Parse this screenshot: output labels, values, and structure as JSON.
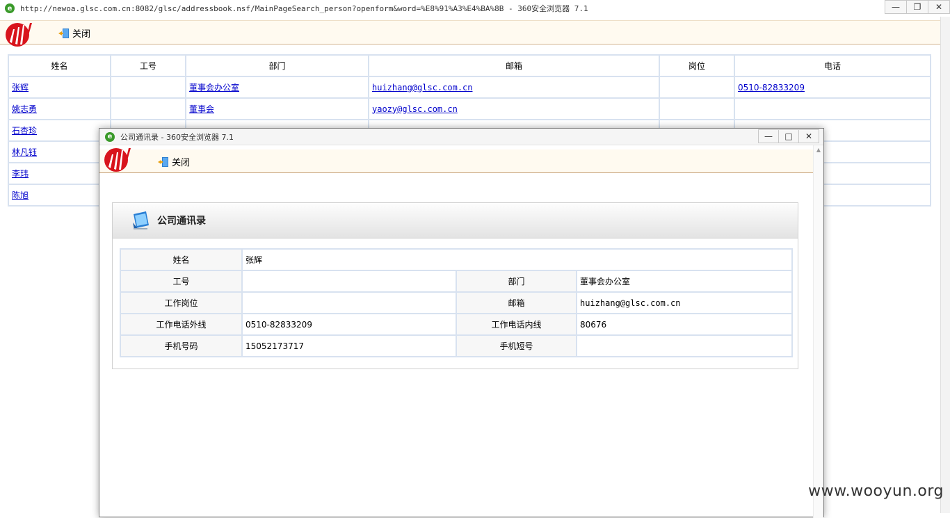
{
  "outer_window": {
    "title": "http://newoa.glsc.com.cn:8082/glsc/addressbook.nsf/MainPageSearch_person?openform&word=%E8%91%A3%E4%BA%8B - 360安全浏览器 7.1",
    "close_label": "关闭"
  },
  "results_table": {
    "headers": [
      "姓名",
      "工号",
      "部门",
      "邮箱",
      "岗位",
      "电话"
    ],
    "rows": [
      {
        "name": "张辉",
        "id": "",
        "dept": "董事会办公室",
        "email": "huizhang@glsc.com.cn",
        "post": "",
        "phone": "0510-82833209"
      },
      {
        "name": "姚志勇",
        "id": "",
        "dept": "董事会",
        "email": "yaozy@glsc.com.cn",
        "post": "",
        "phone": ""
      },
      {
        "name": "石杏珍",
        "id": "",
        "dept": "",
        "email": "",
        "post": "",
        "phone": ""
      },
      {
        "name": "林凡钰",
        "id": "",
        "dept": "",
        "email": "",
        "post": "",
        "phone": ""
      },
      {
        "name": "李玮",
        "id": "",
        "dept": "",
        "email": "",
        "post": "",
        "phone": ""
      },
      {
        "name": "陈旭",
        "id": "",
        "dept": "",
        "email": "",
        "post": "",
        "phone": ""
      }
    ]
  },
  "popup": {
    "title": "公司通讯录 - 360安全浏览器 7.1",
    "close_label": "关闭",
    "card_title": "公司通讯录",
    "fields": {
      "name_label": "姓名",
      "name_value": "张辉",
      "id_label": "工号",
      "id_value": "",
      "dept_label": "部门",
      "dept_value": "董事会办公室",
      "post_label": "工作岗位",
      "post_value": "",
      "email_label": "邮箱",
      "email_value": "huizhang@glsc.com.cn",
      "ext_label": "工作电话外线",
      "ext_value": "0510-82833209",
      "int_label": "工作电话内线",
      "int_value": "80676",
      "mobile_label": "手机号码",
      "mobile_value": "15052173717",
      "short_label": "手机短号",
      "short_value": ""
    }
  },
  "watermark": "www.wooyun.org"
}
